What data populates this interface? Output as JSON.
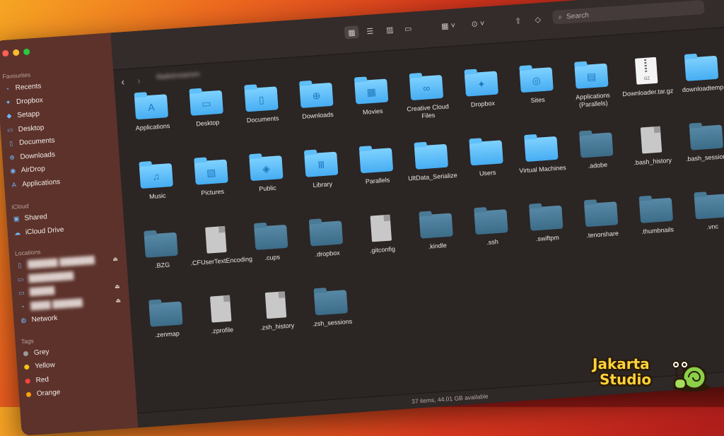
{
  "toolbar": {
    "search_placeholder": "Search",
    "path_title": "ifadeimownen"
  },
  "sidebar": {
    "sections": {
      "favourites": "Favourites",
      "icloud": "iCloud",
      "locations": "Locations",
      "tags": "Tags"
    },
    "favourites": [
      {
        "label": "Recents",
        "icon": "clock-icon"
      },
      {
        "label": "Dropbox",
        "icon": "dropbox-icon"
      },
      {
        "label": "Setapp",
        "icon": "setapp-icon"
      },
      {
        "label": "Desktop",
        "icon": "desktop-icon"
      },
      {
        "label": "Documents",
        "icon": "document-icon"
      },
      {
        "label": "Downloads",
        "icon": "download-icon"
      },
      {
        "label": "AirDrop",
        "icon": "airdrop-icon"
      },
      {
        "label": "Applications",
        "icon": "applications-icon"
      }
    ],
    "icloud": [
      {
        "label": "Shared",
        "icon": "shared-folder-icon"
      },
      {
        "label": "iCloud Drive",
        "icon": "cloud-icon"
      }
    ],
    "locations": [
      {
        "label": "Network",
        "icon": "globe-icon"
      }
    ],
    "tags": [
      {
        "label": "Grey",
        "color": "#9a9a9a"
      },
      {
        "label": "Yellow",
        "color": "#f5c518"
      },
      {
        "label": "Red",
        "color": "#ff453a"
      },
      {
        "label": "Orange",
        "color": "#ff9f0a"
      }
    ]
  },
  "files": [
    {
      "name": "Applications",
      "type": "folder",
      "glyph": "A"
    },
    {
      "name": "Desktop",
      "type": "folder",
      "glyph": "▭"
    },
    {
      "name": "Documents",
      "type": "folder",
      "glyph": "▯"
    },
    {
      "name": "Downloads",
      "type": "folder",
      "glyph": "⊕"
    },
    {
      "name": "Movies",
      "type": "folder",
      "glyph": "▦"
    },
    {
      "name": "Creative Cloud Files",
      "type": "folder",
      "glyph": "∞"
    },
    {
      "name": "Dropbox",
      "type": "folder",
      "glyph": "✦"
    },
    {
      "name": "Sites",
      "type": "folder",
      "glyph": "◎"
    },
    {
      "name": "Applications (Parallels)",
      "type": "folder",
      "glyph": "▤"
    },
    {
      "name": "Downloader.tar.gz",
      "type": "gz",
      "glyph": "GZ"
    },
    {
      "name": "downloadtemp",
      "type": "folder",
      "glyph": ""
    },
    {
      "name": "Music",
      "type": "folder",
      "glyph": "♫"
    },
    {
      "name": "Pictures",
      "type": "folder",
      "glyph": "▨"
    },
    {
      "name": "Public",
      "type": "folder",
      "glyph": "◈"
    },
    {
      "name": "Library",
      "type": "folder",
      "glyph": "Ⅲ"
    },
    {
      "name": "Parallels",
      "type": "folder",
      "glyph": ""
    },
    {
      "name": "UltData_Serialize",
      "type": "folder",
      "glyph": ""
    },
    {
      "name": "Users",
      "type": "folder",
      "glyph": ""
    },
    {
      "name": "Virtual Machines",
      "type": "folder",
      "glyph": ""
    },
    {
      "name": ".adobe",
      "type": "hidden-folder",
      "glyph": ""
    },
    {
      "name": ".bash_history",
      "type": "doc",
      "glyph": ""
    },
    {
      "name": ".bash_sessions",
      "type": "hidden-folder",
      "glyph": ""
    },
    {
      "name": ".BZG",
      "type": "hidden-folder",
      "glyph": ""
    },
    {
      "name": ".CFUserTextEncoding",
      "type": "doc",
      "glyph": ""
    },
    {
      "name": ".cups",
      "type": "hidden-folder",
      "glyph": ""
    },
    {
      "name": ".dropbox",
      "type": "hidden-folder",
      "glyph": ""
    },
    {
      "name": ".gitconfig",
      "type": "doc",
      "glyph": ""
    },
    {
      "name": ".kindle",
      "type": "hidden-folder",
      "glyph": ""
    },
    {
      "name": ".ssh",
      "type": "hidden-folder",
      "glyph": ""
    },
    {
      "name": ".swiftpm",
      "type": "hidden-folder",
      "glyph": ""
    },
    {
      "name": ".tenorshare",
      "type": "hidden-folder",
      "glyph": ""
    },
    {
      "name": ".thumbnails",
      "type": "hidden-folder",
      "glyph": ""
    },
    {
      "name": ".vnc",
      "type": "hidden-folder",
      "glyph": ""
    },
    {
      "name": ".zenmap",
      "type": "hidden-folder",
      "glyph": ""
    },
    {
      "name": ".zprofile",
      "type": "doc",
      "glyph": ""
    },
    {
      "name": ".zsh_history",
      "type": "doc",
      "glyph": ""
    },
    {
      "name": ".zsh_sessions",
      "type": "hidden-folder",
      "glyph": ""
    }
  ],
  "status": {
    "text": "37 items, 44.01 GB available"
  },
  "watermark": {
    "line1": "Jakarta",
    "line2": "Studio"
  }
}
